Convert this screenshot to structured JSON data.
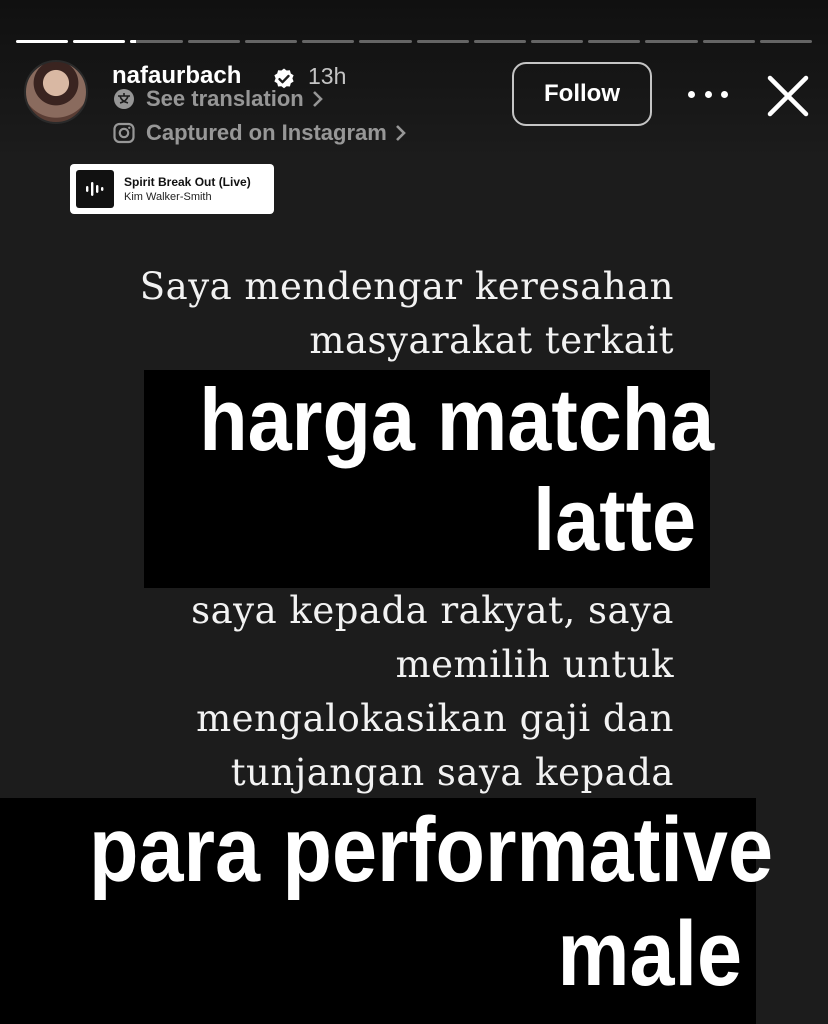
{
  "story": {
    "progress": {
      "segments": 14,
      "current_index": 2,
      "current_fraction": 0.1
    }
  },
  "header": {
    "username": "nafaurbach",
    "verified": true,
    "time_ago": "13h",
    "see_translation": "See translation",
    "captured_on": "Captured on Instagram",
    "follow_label": "Follow",
    "icons": {
      "more": "more-horizontal-icon",
      "close": "close-icon",
      "translate": "translate-icon",
      "camera": "camera-icon",
      "verified": "verified-badge-icon",
      "chevron": "chevron-right-icon"
    }
  },
  "music_sticker": {
    "title": "Spirit Break Out (Live)",
    "artist": "Kim Walker-Smith",
    "icon": "audio-wave-icon"
  },
  "content": {
    "intro_lines": [
      "Saya mendengar keresahan",
      "masyarakat terkait"
    ],
    "highlight1_lines": [
      "harga matcha",
      "latte"
    ],
    "middle_lines": [
      "saya kepada rakyat, saya",
      "memilih untuk",
      "mengalokasikan gaji dan",
      "tunjangan saya kepada"
    ],
    "highlight2_lines": [
      "para performative",
      "male"
    ]
  },
  "colors": {
    "background": "#1c1c1c",
    "highlight_bg": "#000000",
    "text": "#ffffff",
    "verified_blue": "#ffffff"
  }
}
